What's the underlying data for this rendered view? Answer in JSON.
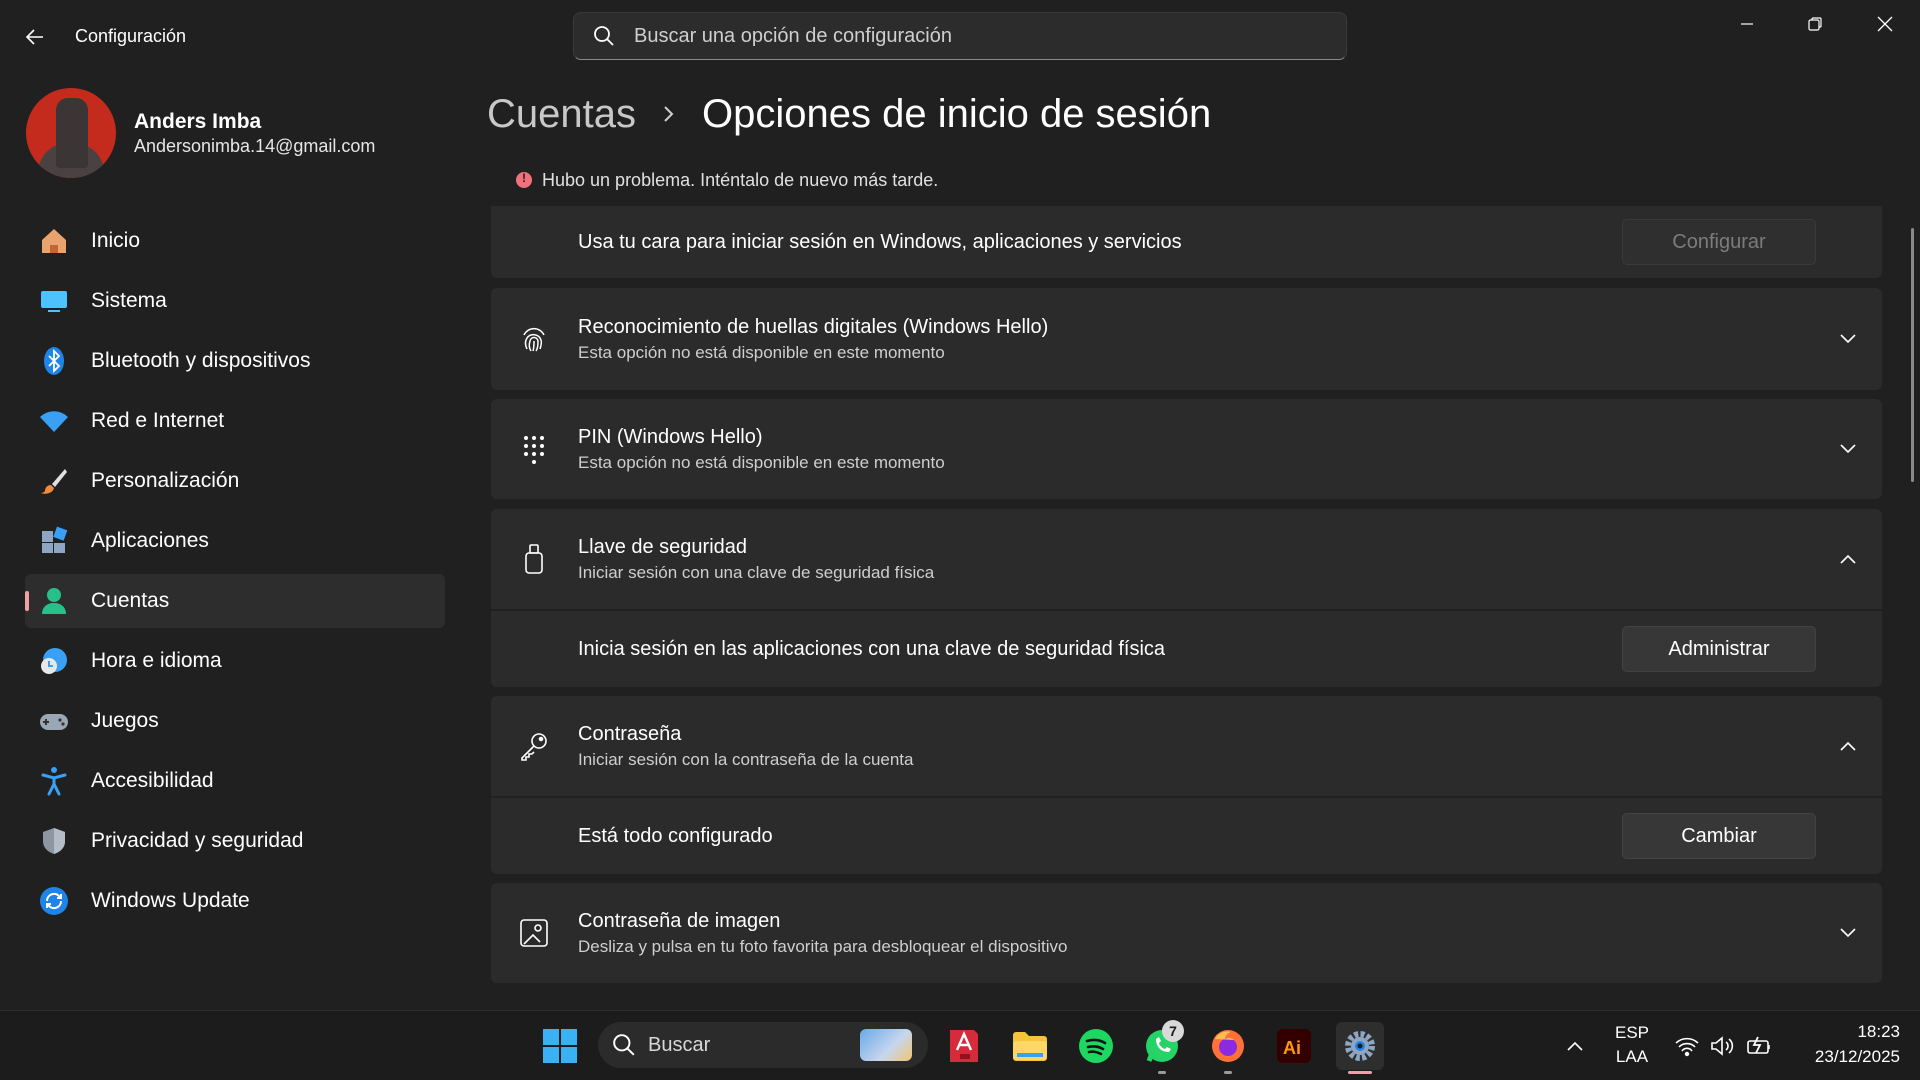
{
  "window": {
    "title": "Configuración",
    "search_placeholder": "Buscar una opción de configuración"
  },
  "profile": {
    "name": "Anders Imba",
    "email": "Andersonimba.14@gmail.com"
  },
  "sidebar": {
    "items": [
      {
        "label": "Inicio",
        "icon": "home-icon"
      },
      {
        "label": "Sistema",
        "icon": "system-icon"
      },
      {
        "label": "Bluetooth y dispositivos",
        "icon": "bluetooth-icon"
      },
      {
        "label": "Red e Internet",
        "icon": "wifi-icon"
      },
      {
        "label": "Personalización",
        "icon": "brush-icon"
      },
      {
        "label": "Aplicaciones",
        "icon": "apps-icon"
      },
      {
        "label": "Cuentas",
        "icon": "accounts-icon",
        "active": true
      },
      {
        "label": "Hora e idioma",
        "icon": "clock-globe-icon"
      },
      {
        "label": "Juegos",
        "icon": "gamepad-icon"
      },
      {
        "label": "Accesibilidad",
        "icon": "accessibility-icon"
      },
      {
        "label": "Privacidad y seguridad",
        "icon": "shield-icon"
      },
      {
        "label": "Windows Update",
        "icon": "update-icon"
      }
    ]
  },
  "breadcrumb": {
    "parent": "Cuentas",
    "current": "Opciones de inicio de sesión"
  },
  "error": {
    "text": "Hubo un problema. Inténtalo de nuevo más tarde."
  },
  "face": {
    "text": "Usa tu cara para iniciar sesión en Windows, aplicaciones y servicios",
    "button": "Configurar"
  },
  "fingerprint": {
    "title": "Reconocimiento de huellas digitales (Windows Hello)",
    "desc": "Esta opción no está disponible en este momento"
  },
  "pin": {
    "title": "PIN (Windows Hello)",
    "desc": "Esta opción no está disponible en este momento"
  },
  "security_key": {
    "title": "Llave de seguridad",
    "desc": "Iniciar sesión con una clave de seguridad física",
    "sub_text": "Inicia sesión en las aplicaciones con una clave de seguridad física",
    "button": "Administrar"
  },
  "password": {
    "title": "Contraseña",
    "desc": "Iniciar sesión con la contraseña de la cuenta",
    "sub_text": "Está todo configurado",
    "button": "Cambiar"
  },
  "picture_password": {
    "title": "Contraseña de imagen",
    "desc": "Desliza y pulsa en tu foto favorita para desbloquear el dispositivo"
  },
  "taskbar": {
    "search_label": "Buscar",
    "whatsapp_badge": "7",
    "language_top": "ESP",
    "language_bottom": "LAA",
    "time": "18:23",
    "date": "23/12/2025"
  },
  "colors": {
    "accent": "#f0a0a6",
    "background": "#202020",
    "card": "#2b2b2b",
    "error": "#f1707b"
  }
}
